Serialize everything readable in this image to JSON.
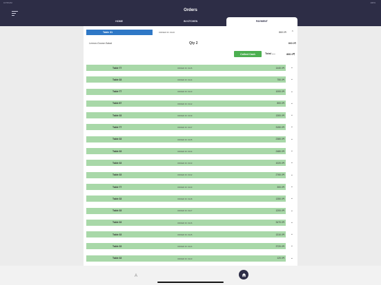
{
  "status": {
    "time": "10:58 AM",
    "battery": "100%"
  },
  "header": {
    "title": "Orders"
  },
  "tabs": [
    {
      "label": "HOME"
    },
    {
      "label": "IN KITCHEN"
    },
    {
      "label": "PAYMENT"
    }
  ],
  "expanded": {
    "table": "Table 31",
    "order_id": "ORDER ID: #146",
    "amount": "860.0₹",
    "item": "Lemon-Goose-Salad",
    "qty": "Qty 2",
    "item_amount": "860.0₹",
    "collect_label": "Collect Cash",
    "total_label": "Total ----",
    "total_amount": "860.0₹"
  },
  "orders": [
    {
      "table": "Table 77",
      "order_id": "ORDER ID: #145",
      "amount": "1440.0₹"
    },
    {
      "table": "Table 33",
      "order_id": "ORDER ID: #144",
      "amount": "750.0₹"
    },
    {
      "table": "Table 77",
      "order_id": "ORDER ID: #143",
      "amount": "1000.0₹"
    },
    {
      "table": "Table 87",
      "order_id": "ORDER ID: #142",
      "amount": "800.0₹"
    },
    {
      "table": "Table 33",
      "order_id": "ORDER ID: #139",
      "amount": "1300.0₹"
    },
    {
      "table": "Table 77",
      "order_id": "ORDER ID: #137",
      "amount": "3150.0₹"
    },
    {
      "table": "Table 33",
      "order_id": "ORDER ID: #135",
      "amount": "2380.0₹"
    },
    {
      "table": "Table 33",
      "order_id": "ORDER ID: #134",
      "amount": "2480.0₹"
    },
    {
      "table": "Table 33",
      "order_id": "ORDER ID: #133",
      "amount": "1020.0₹"
    },
    {
      "table": "Table 33",
      "order_id": "ORDER ID: #132",
      "amount": "2760.0₹"
    },
    {
      "table": "Table 77",
      "order_id": "ORDER ID: #130",
      "amount": "300.0₹"
    },
    {
      "table": "Table 33",
      "order_id": "ORDER ID: #128",
      "amount": "1350.0₹"
    },
    {
      "table": "Table 33",
      "order_id": "ORDER ID: #127",
      "amount": "1200.0₹"
    },
    {
      "table": "Table 33",
      "order_id": "ORDER ID: #126",
      "amount": "3470.0₹"
    },
    {
      "table": "Table 33",
      "order_id": "ORDER ID: #125",
      "amount": "1310.0₹"
    },
    {
      "table": "Table 33",
      "order_id": "ORDER ID: #124",
      "amount": "3720.0₹"
    },
    {
      "table": "Table 33",
      "order_id": "ORDER ID: #123",
      "amount": "120.0₹"
    }
  ],
  "bottom": {
    "left_glyph": "A"
  },
  "colors": {
    "header": "#2d2d46",
    "accent": "#2f78c6",
    "row": "#a8d8a8",
    "button": "#4caf50"
  }
}
